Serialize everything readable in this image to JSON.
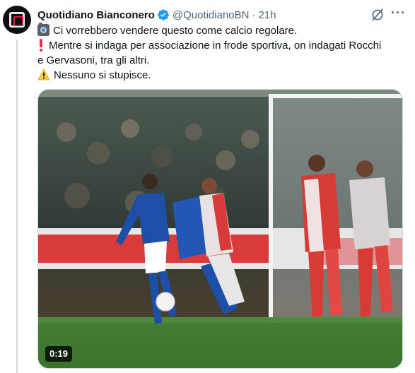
{
  "author": {
    "name": "Quotidiano Bianconero",
    "handle": "@QuotidianoBN",
    "separator": "·",
    "time": "21h",
    "verified": true,
    "avatar_icon": "quotidiano-logo"
  },
  "tweet": {
    "line1": "Ci vorrebbero vendere questo come calcio regolare.",
    "line2": "Mentre si indaga per associazione in frode sportiva, on indagati Rocchi",
    "line3": "e Gervasoni, tra gli altri.",
    "line4": "Nessuno si stupisce.",
    "emoji_line1": "camera-emoji",
    "emoji_line2": "exclamation-emoji",
    "emoji_line4": "warning-emoji"
  },
  "media": {
    "type": "video",
    "duration": "0:19",
    "scene": "football-match-still"
  },
  "actions": {
    "grok_icon": "grok-icon",
    "more_icon": "more-icon",
    "more_label": "···"
  },
  "colors": {
    "text": "#0f1419",
    "secondary": "#536471",
    "verified": "#1d9bf0",
    "divider": "#cfd9de"
  }
}
